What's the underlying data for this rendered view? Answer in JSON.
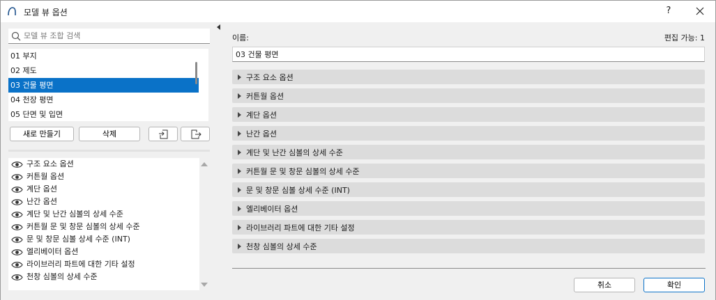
{
  "window": {
    "title": "모델 뷰 옵션",
    "help_label": "?",
    "close_label": "close"
  },
  "search": {
    "placeholder": "모델 뷰 조합 검색"
  },
  "view_list": {
    "items": [
      {
        "label": "01 부지",
        "selected": false
      },
      {
        "label": "02 제도",
        "selected": false
      },
      {
        "label": "03 건물 평면",
        "selected": true
      },
      {
        "label": "04 천장 평면",
        "selected": false
      },
      {
        "label": "05 단면 및 입면",
        "selected": false
      }
    ]
  },
  "buttons": {
    "new_label": "새로 만들기",
    "delete_label": "삭제",
    "import_icon": "import-icon",
    "export_icon": "export-icon"
  },
  "option_list": {
    "items": [
      "구조 요소 옵션",
      "커튼월 옵션",
      "계단 옵션",
      "난간 옵션",
      "계단 및 난간 심볼의 상세 수준",
      "커튼월 문 및 창문 심볼의 상세 수준",
      "문 및 창문 심볼 상세 수준 (INT)",
      "엘리베이터 옵션",
      "라이브러리 파트에 대한 기타 설정",
      "천창 심볼의 상세 수준"
    ]
  },
  "right": {
    "name_label": "이름:",
    "edit_status": "편집 가능: 1",
    "name_value": "03 건물 평면",
    "sections": [
      "구조 요소 옵션",
      "커튼월 옵션",
      "계단 옵션",
      "난간 옵션",
      "계단 및 난간 심볼의 상세 수준",
      "커튼월 문 및 창문 심볼의 상세 수준",
      "문 및 창문 심볼 상세 수준 (INT)",
      "엘리베이터 옵션",
      "라이브러리 파트에 대한 기타 설정",
      "천창 심볼의 상세 수준"
    ],
    "cancel_label": "취소",
    "ok_label": "확인"
  },
  "colors": {
    "selection": "#0a72c8",
    "section_bg": "#dcdcdc",
    "panel_bg": "#f0f0f0"
  }
}
